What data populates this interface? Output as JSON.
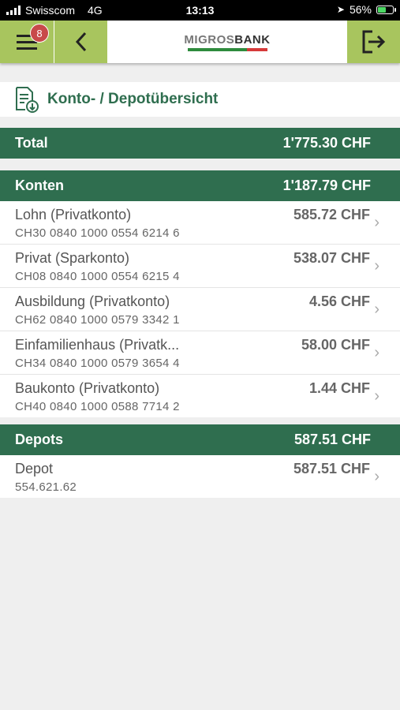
{
  "status": {
    "carrier": "Swisscom",
    "network": "4G",
    "time": "13:13",
    "battery": "56%",
    "battery_level": 0.56
  },
  "navbar": {
    "badge_count": "8",
    "logo_part1": "MIGROS",
    "logo_part2": "BANK"
  },
  "page": {
    "title": "Konto- / Depotübersicht"
  },
  "total": {
    "label": "Total",
    "value": "1'775.30 CHF"
  },
  "konten": {
    "label": "Konten",
    "value": "1'187.79 CHF",
    "items": [
      {
        "name": "Lohn (Privatkonto)",
        "iban": "CH30 0840 1000 0554 6214 6",
        "amount": "585.72 CHF"
      },
      {
        "name": "Privat (Sparkonto)",
        "iban": "CH08 0840 1000 0554 6215 4",
        "amount": "538.07 CHF"
      },
      {
        "name": "Ausbildung (Privatkonto)",
        "iban": "CH62 0840 1000 0579 3342 1",
        "amount": "4.56 CHF"
      },
      {
        "name": "Einfamilienhaus (Privatk...",
        "iban": "CH34 0840 1000 0579 3654 4",
        "amount": "58.00 CHF"
      },
      {
        "name": "Baukonto (Privatkonto)",
        "iban": "CH40 0840 1000 0588 7714 2",
        "amount": "1.44 CHF"
      }
    ]
  },
  "depots": {
    "label": "Depots",
    "value": "587.51 CHF",
    "items": [
      {
        "name": "Depot",
        "number": "554.621.62",
        "amount": "587.51 CHF"
      }
    ]
  },
  "colors": {
    "brand_green": "#2f6e4f",
    "nav_green": "#a8c55e",
    "badge_red": "#c84a4a"
  }
}
